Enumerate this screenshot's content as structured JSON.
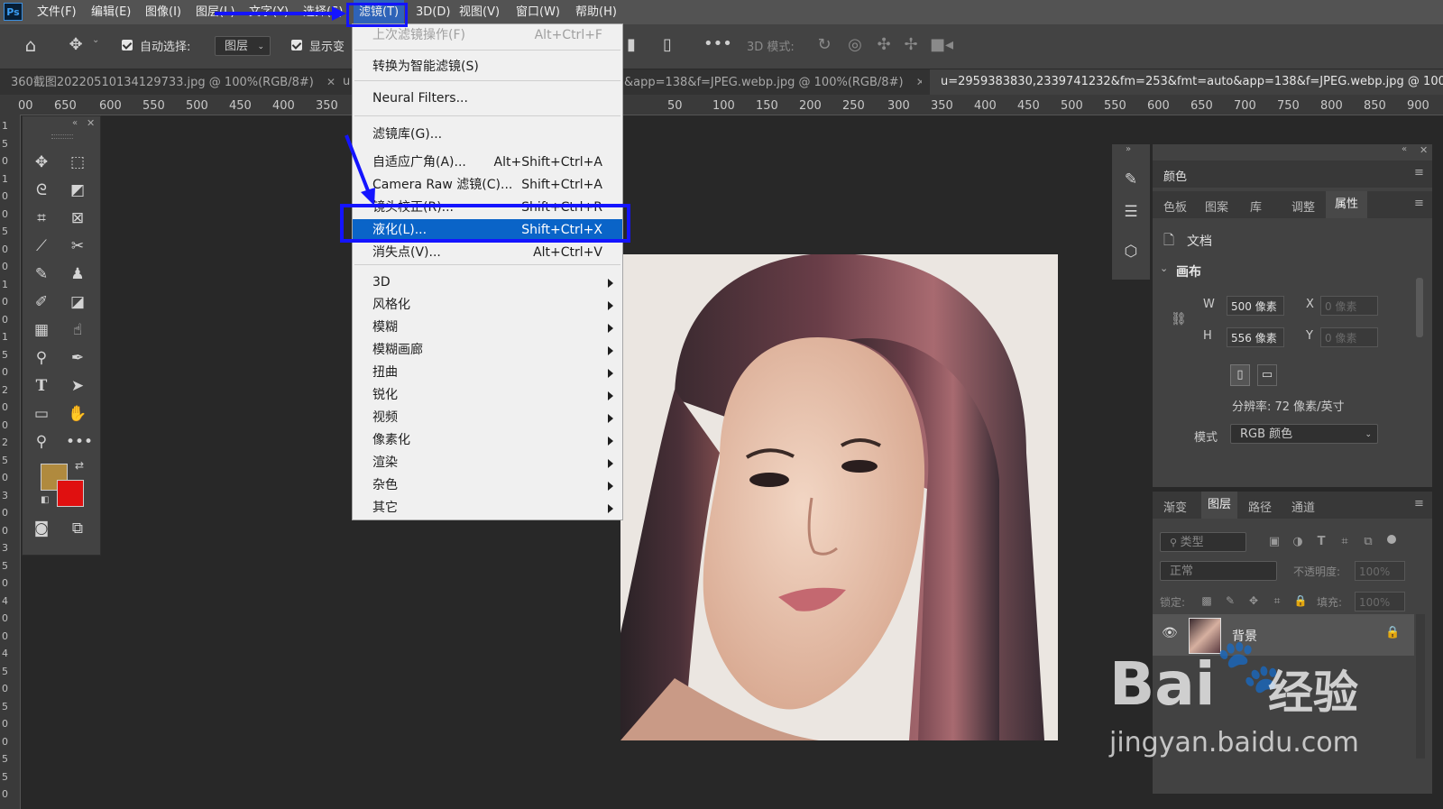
{
  "menubar": {
    "logo": "Ps",
    "items": [
      "文件(F)",
      "编辑(E)",
      "图像(I)",
      "图层(L)",
      "文字(Y)",
      "选择(S)",
      "滤镜(T)",
      "3D(D)",
      "视图(V)",
      "窗口(W)",
      "帮助(H)"
    ]
  },
  "options": {
    "auto_select_label": "自动选择:",
    "auto_select_target": "图层",
    "show_transform_label": "显示变",
    "mode3d_label": "3D 模式:"
  },
  "tabs": [
    {
      "title": "360截图20220510134129733.jpg @ 100%(RGB/8#)",
      "active": false
    },
    {
      "title": "u",
      "active": false
    },
    {
      "title": "&app=138&f=JPEG.webp.jpg @ 100%(RGB/8#)",
      "active": false
    },
    {
      "title": "u=2959383830,2339741232&fm=253&fmt=auto&app=138&f=JPEG.webp.jpg @ 100%",
      "active": true
    }
  ],
  "ruler_top": [
    "00",
    "650",
    "600",
    "550",
    "500",
    "450",
    "400",
    "350",
    "50",
    "100",
    "150",
    "200",
    "250",
    "300",
    "350",
    "400",
    "450",
    "500",
    "550",
    "600",
    "650",
    "700",
    "750",
    "800",
    "850",
    "900"
  ],
  "ruler_left": [
    "1",
    "5",
    "0",
    "1",
    "0",
    "0",
    "5",
    "0",
    "0",
    "1",
    "0",
    "0",
    "1",
    "5",
    "0",
    "2",
    "0",
    "0",
    "2",
    "5",
    "0",
    "3",
    "0",
    "0",
    "3",
    "5",
    "0",
    "4",
    "0",
    "0",
    "4",
    "5",
    "0",
    "5",
    "0",
    "0",
    "5",
    "5",
    "0"
  ],
  "filter_menu": {
    "items": [
      {
        "label": "上次滤镜操作(F)",
        "shortcut": "Alt+Ctrl+F",
        "disabled": true
      },
      {
        "label": "转换为智能滤镜(S)",
        "shortcut": ""
      },
      {
        "label": "Neural Filters...",
        "shortcut": ""
      },
      {
        "label": "滤镜库(G)...",
        "shortcut": ""
      },
      {
        "label": "自适应广角(A)...",
        "shortcut": "Alt+Shift+Ctrl+A"
      },
      {
        "label": "Camera Raw 滤镜(C)...",
        "shortcut": "Shift+Ctrl+A"
      },
      {
        "label": "镜头校正(R)...",
        "shortcut": "Shift+Ctrl+R"
      },
      {
        "label": "液化(L)...",
        "shortcut": "Shift+Ctrl+X",
        "highlighted": true
      },
      {
        "label": "消失点(V)...",
        "shortcut": "Alt+Ctrl+V"
      },
      {
        "label": "3D",
        "submenu": true
      },
      {
        "label": "风格化",
        "submenu": true
      },
      {
        "label": "模糊",
        "submenu": true
      },
      {
        "label": "模糊画廊",
        "submenu": true
      },
      {
        "label": "扭曲",
        "submenu": true
      },
      {
        "label": "锐化",
        "submenu": true
      },
      {
        "label": "视频",
        "submenu": true
      },
      {
        "label": "像素化",
        "submenu": true
      },
      {
        "label": "渲染",
        "submenu": true
      },
      {
        "label": "杂色",
        "submenu": true
      },
      {
        "label": "其它",
        "submenu": true
      }
    ]
  },
  "colors": {
    "foreground": "#b08a3e",
    "background": "#e01010",
    "accent": "#0a64c8",
    "annotation": "#1414ff"
  },
  "props_panel": {
    "title": "颜色",
    "tabs": [
      "色板",
      "图案",
      "库",
      "调整",
      "属性"
    ],
    "active_tab": "属性",
    "doc_label": "文档",
    "section": "画布",
    "w_label": "W",
    "w_value": "500 像素",
    "h_label": "H",
    "h_value": "556 像素",
    "x_label": "X",
    "x_value": "0 像素",
    "y_label": "Y",
    "y_value": "0 像素",
    "resolution": "分辨率: 72 像素/英寸",
    "mode_label": "模式",
    "mode_value": "RGB 颜色"
  },
  "layers_panel": {
    "tabs": [
      "渐变",
      "图层",
      "路径",
      "通道"
    ],
    "active_tab": "图层",
    "filter_placeholder": "类型",
    "blend_mode": "正常",
    "opacity_label": "不透明度:",
    "opacity_value": "100%",
    "lock_label": "锁定:",
    "fill_label": "填充:",
    "fill_value": "100%",
    "layer_name": "背景"
  },
  "watermark": {
    "line1": "Bai",
    "line2": "经验",
    "line3": "jingyan.baidu.com"
  }
}
